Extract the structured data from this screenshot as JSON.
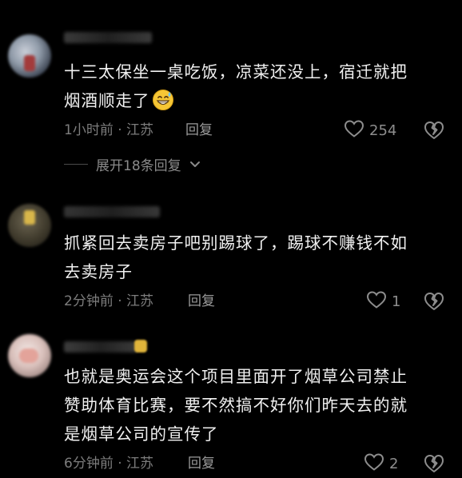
{
  "comments": [
    {
      "text_line1": "十三太保坐一桌吃饭，凉菜还没上，宿迁就把",
      "text_line2": "烟酒顺走了",
      "time_location": "1小时前 · 江苏",
      "reply_label": "回复",
      "like_count": "254",
      "emoji": "grinning-sweat-emoji"
    },
    {
      "text_line1": "抓紧回去卖房子吧别踢球了，踢球不赚钱不如",
      "text_line2": "去卖房子",
      "time_location": "2分钟前 · 江苏",
      "reply_label": "回复",
      "like_count": "1"
    },
    {
      "text_line1": "也就是奥运会这个项目里面开了烟草公司禁止",
      "text_line2": "赞助体育比赛，要不然搞不好你们昨天去的就",
      "text_line3": "是烟草公司的宣传了",
      "time_location": "6分钟前 · 江苏",
      "reply_label": "回复",
      "like_count": "2"
    }
  ],
  "expand_replies": {
    "label": "展开18条回复"
  },
  "colors": {
    "background": "#000000",
    "text": "#f1f1f1",
    "meta": "#7d7d7d",
    "icon": "#8d8d8d"
  }
}
